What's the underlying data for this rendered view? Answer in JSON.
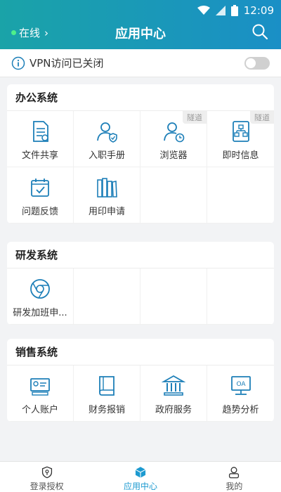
{
  "status_bar": {
    "time": "12:09"
  },
  "header": {
    "status_label": "在线",
    "title": "应用中心"
  },
  "vpn": {
    "message": "VPN访问已关闭",
    "enabled": false
  },
  "sections": [
    {
      "title": "办公系统",
      "apps": [
        {
          "label": "文件共享",
          "icon": "document-icon"
        },
        {
          "label": "入职手册",
          "icon": "user-shield-icon"
        },
        {
          "label": "浏览器",
          "icon": "user-clock-icon",
          "tag": "隧道"
        },
        {
          "label": "即时信息",
          "icon": "org-chart-icon",
          "tag": "隧道"
        },
        {
          "label": "问题反馈",
          "icon": "calendar-check-icon"
        },
        {
          "label": "用印申请",
          "icon": "books-icon"
        }
      ]
    },
    {
      "title": "研发系统",
      "apps": [
        {
          "label": "研发加班申...",
          "icon": "chrome-icon"
        }
      ]
    },
    {
      "title": "销售系统",
      "apps": [
        {
          "label": "个人账户",
          "icon": "account-icon"
        },
        {
          "label": "财务报销",
          "icon": "book-icon"
        },
        {
          "label": "政府服务",
          "icon": "bank-icon"
        },
        {
          "label": "趋势分析",
          "icon": "oa-monitor-icon"
        }
      ]
    }
  ],
  "tabbar": [
    {
      "label": "登录授权",
      "icon": "shield-key-icon",
      "active": false
    },
    {
      "label": "应用中心",
      "icon": "cube-icon",
      "active": true
    },
    {
      "label": "我的",
      "icon": "profile-icon",
      "active": false
    }
  ],
  "colors": {
    "header_start": "#1aa3a8",
    "header_end": "#1a8fc6",
    "icon": "#1d7fb8",
    "active_tab": "#1d9ad0"
  }
}
